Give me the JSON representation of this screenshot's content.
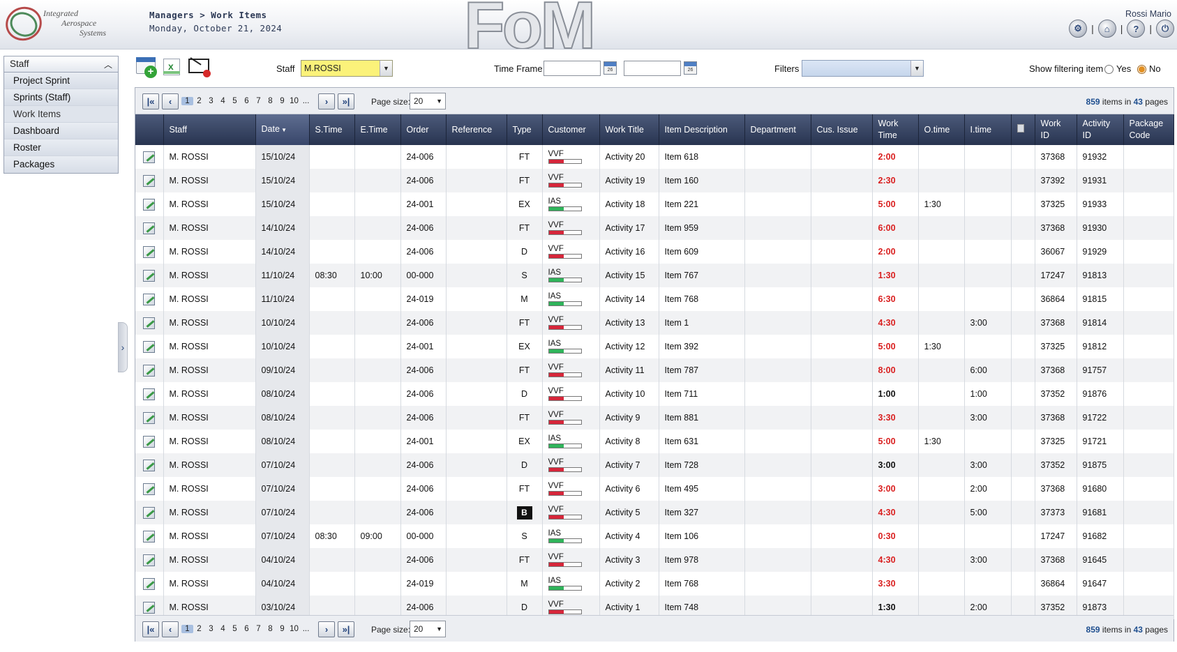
{
  "header": {
    "logo_lines": [
      "Integrated",
      "Aerospace",
      "Systems"
    ],
    "breadcrumb": "Managers > Work Items",
    "date": "Monday, October 21, 2024",
    "watermark": "FoM",
    "user": "Rossi Mario",
    "icons": [
      "gear-icon",
      "home-icon",
      "help-icon",
      "power-icon"
    ]
  },
  "sidebar": {
    "header": "Staff",
    "items": [
      {
        "label": "Project Sprint"
      },
      {
        "label": "Sprints (Staff)"
      },
      {
        "label": "Work Items"
      },
      {
        "label": "Dashboard"
      },
      {
        "label": "Roster"
      },
      {
        "label": "Packages"
      }
    ]
  },
  "toolbar": {
    "staff_label": "Staff",
    "staff_value": "M.ROSSI",
    "timeframe_label": "Time Frame",
    "timeframe_from": "",
    "timeframe_to": "",
    "calendar_glyph": "26",
    "filters_label": "Filters",
    "filters_value": "",
    "show_filtering_label": "Show filtering item",
    "yes": "Yes",
    "no": "No",
    "selected": "No"
  },
  "pager": {
    "pages": [
      "1",
      "2",
      "3",
      "4",
      "5",
      "6",
      "7",
      "8",
      "9",
      "10",
      "..."
    ],
    "current": "1",
    "page_size_label": "Page size:",
    "page_size": "20",
    "total_items": "859",
    "items_in": "items in",
    "total_pages": "43",
    "pages_label": "pages"
  },
  "colors": {
    "header_bg": "#283450",
    "accent_red": "#d91e1e",
    "vvf_bar": "#d6263a",
    "ias_bar": "#2fb35a",
    "staff_select": "#fbf27a"
  },
  "table": {
    "columns": [
      "",
      "Staff",
      "Date",
      "S.Time",
      "E.Time",
      "Order",
      "Reference",
      "Type",
      "Customer",
      "Work Title",
      "Item Description",
      "Department",
      "Cus. Issue",
      "Work Time",
      "O.time",
      "I.time",
      "",
      "Work ID",
      "Activity ID",
      "Package Code"
    ],
    "rows": [
      {
        "staff": "M. ROSSI",
        "date": "15/10/24",
        "stime": "",
        "etime": "",
        "order": "24-006",
        "ref": "",
        "type": "FT",
        "cust": "VVF",
        "title": "Activity 20",
        "desc": "Item 618",
        "dept": "",
        "issue": "",
        "wt": "2:00",
        "wt_red": true,
        "ot": "",
        "it": "",
        "wid": "37368",
        "aid": "91932",
        "pkg": ""
      },
      {
        "staff": "M. ROSSI",
        "date": "15/10/24",
        "stime": "",
        "etime": "",
        "order": "24-006",
        "ref": "",
        "type": "FT",
        "cust": "VVF",
        "title": "Activity 19",
        "desc": "Item 160",
        "dept": "",
        "issue": "",
        "wt": "2:30",
        "wt_red": true,
        "ot": "",
        "it": "",
        "wid": "37392",
        "aid": "91931",
        "pkg": ""
      },
      {
        "staff": "M. ROSSI",
        "date": "15/10/24",
        "stime": "",
        "etime": "",
        "order": "24-001",
        "ref": "",
        "type": "EX",
        "cust": "IAS",
        "title": "Activity 18",
        "desc": "Item 221",
        "dept": "",
        "issue": "",
        "wt": "5:00",
        "wt_red": true,
        "ot": "1:30",
        "it": "",
        "wid": "37325",
        "aid": "91933",
        "pkg": ""
      },
      {
        "staff": "M. ROSSI",
        "date": "14/10/24",
        "stime": "",
        "etime": "",
        "order": "24-006",
        "ref": "",
        "type": "FT",
        "cust": "VVF",
        "title": "Activity 17",
        "desc": "Item 959",
        "dept": "",
        "issue": "",
        "wt": "6:00",
        "wt_red": true,
        "ot": "",
        "it": "",
        "wid": "37368",
        "aid": "91930",
        "pkg": ""
      },
      {
        "staff": "M. ROSSI",
        "date": "14/10/24",
        "stime": "",
        "etime": "",
        "order": "24-006",
        "ref": "",
        "type": "D",
        "cust": "VVF",
        "title": "Activity 16",
        "desc": "Item 609",
        "dept": "",
        "issue": "",
        "wt": "2:00",
        "wt_red": true,
        "ot": "",
        "it": "",
        "wid": "36067",
        "aid": "91929",
        "pkg": ""
      },
      {
        "staff": "M. ROSSI",
        "date": "11/10/24",
        "stime": "08:30",
        "etime": "10:00",
        "order": "00-000",
        "ref": "",
        "type": "S",
        "cust": "IAS",
        "title": "Activity 15",
        "desc": "Item 767",
        "dept": "",
        "issue": "",
        "wt": "1:30",
        "wt_red": true,
        "ot": "",
        "it": "",
        "wid": "17247",
        "aid": "91813",
        "pkg": ""
      },
      {
        "staff": "M. ROSSI",
        "date": "11/10/24",
        "stime": "",
        "etime": "",
        "order": "24-019",
        "ref": "",
        "type": "M",
        "cust": "IAS",
        "title": "Activity 14",
        "desc": "Item 768",
        "dept": "",
        "issue": "",
        "wt": "6:30",
        "wt_red": true,
        "ot": "",
        "it": "",
        "wid": "36864",
        "aid": "91815",
        "pkg": ""
      },
      {
        "staff": "M. ROSSI",
        "date": "10/10/24",
        "stime": "",
        "etime": "",
        "order": "24-006",
        "ref": "",
        "type": "FT",
        "cust": "VVF",
        "title": "Activity 13",
        "desc": "Item 1",
        "dept": "",
        "issue": "",
        "wt": "4:30",
        "wt_red": true,
        "ot": "",
        "it": "3:00",
        "wid": "37368",
        "aid": "91814",
        "pkg": ""
      },
      {
        "staff": "M. ROSSI",
        "date": "10/10/24",
        "stime": "",
        "etime": "",
        "order": "24-001",
        "ref": "",
        "type": "EX",
        "cust": "IAS",
        "title": "Activity 12",
        "desc": "Item 392",
        "dept": "",
        "issue": "",
        "wt": "5:00",
        "wt_red": true,
        "ot": "1:30",
        "it": "",
        "wid": "37325",
        "aid": "91812",
        "pkg": ""
      },
      {
        "staff": "M. ROSSI",
        "date": "09/10/24",
        "stime": "",
        "etime": "",
        "order": "24-006",
        "ref": "",
        "type": "FT",
        "cust": "VVF",
        "title": "Activity 11",
        "desc": "Item 787",
        "dept": "",
        "issue": "",
        "wt": "8:00",
        "wt_red": true,
        "ot": "",
        "it": "6:00",
        "wid": "37368",
        "aid": "91757",
        "pkg": ""
      },
      {
        "staff": "M. ROSSI",
        "date": "08/10/24",
        "stime": "",
        "etime": "",
        "order": "24-006",
        "ref": "",
        "type": "D",
        "cust": "VVF",
        "title": "Activity 10",
        "desc": "Item 711",
        "dept": "",
        "issue": "",
        "wt": "1:00",
        "wt_red": false,
        "ot": "",
        "it": "1:00",
        "wid": "37352",
        "aid": "91876",
        "pkg": ""
      },
      {
        "staff": "M. ROSSI",
        "date": "08/10/24",
        "stime": "",
        "etime": "",
        "order": "24-006",
        "ref": "",
        "type": "FT",
        "cust": "VVF",
        "title": "Activity 9",
        "desc": "Item 881",
        "dept": "",
        "issue": "",
        "wt": "3:30",
        "wt_red": true,
        "ot": "",
        "it": "3:00",
        "wid": "37368",
        "aid": "91722",
        "pkg": ""
      },
      {
        "staff": "M. ROSSI",
        "date": "08/10/24",
        "stime": "",
        "etime": "",
        "order": "24-001",
        "ref": "",
        "type": "EX",
        "cust": "IAS",
        "title": "Activity 8",
        "desc": "Item 631",
        "dept": "",
        "issue": "",
        "wt": "5:00",
        "wt_red": true,
        "ot": "1:30",
        "it": "",
        "wid": "37325",
        "aid": "91721",
        "pkg": ""
      },
      {
        "staff": "M. ROSSI",
        "date": "07/10/24",
        "stime": "",
        "etime": "",
        "order": "24-006",
        "ref": "",
        "type": "D",
        "cust": "VVF",
        "title": "Activity 7",
        "desc": "Item 728",
        "dept": "",
        "issue": "",
        "wt": "3:00",
        "wt_red": false,
        "ot": "",
        "it": "3:00",
        "wid": "37352",
        "aid": "91875",
        "pkg": ""
      },
      {
        "staff": "M. ROSSI",
        "date": "07/10/24",
        "stime": "",
        "etime": "",
        "order": "24-006",
        "ref": "",
        "type": "FT",
        "cust": "VVF",
        "title": "Activity 6",
        "desc": "Item 495",
        "dept": "",
        "issue": "",
        "wt": "3:00",
        "wt_red": true,
        "ot": "",
        "it": "2:00",
        "wid": "37368",
        "aid": "91680",
        "pkg": ""
      },
      {
        "staff": "M. ROSSI",
        "date": "07/10/24",
        "stime": "",
        "etime": "",
        "order": "24-006",
        "ref": "",
        "type": "B",
        "type_badge": true,
        "cust": "VVF",
        "title": "Activity 5",
        "desc": "Item 327",
        "dept": "",
        "issue": "",
        "wt": "4:30",
        "wt_red": true,
        "ot": "",
        "it": "5:00",
        "wid": "37373",
        "aid": "91681",
        "pkg": ""
      },
      {
        "staff": "M. ROSSI",
        "date": "07/10/24",
        "stime": "08:30",
        "etime": "09:00",
        "order": "00-000",
        "ref": "",
        "type": "S",
        "cust": "IAS",
        "title": "Activity 4",
        "desc": "Item 106",
        "dept": "",
        "issue": "",
        "wt": "0:30",
        "wt_red": true,
        "ot": "",
        "it": "",
        "wid": "17247",
        "aid": "91682",
        "pkg": ""
      },
      {
        "staff": "M. ROSSI",
        "date": "04/10/24",
        "stime": "",
        "etime": "",
        "order": "24-006",
        "ref": "",
        "type": "FT",
        "cust": "VVF",
        "title": "Activity 3",
        "desc": "Item 978",
        "dept": "",
        "issue": "",
        "wt": "4:30",
        "wt_red": true,
        "ot": "",
        "it": "3:00",
        "wid": "37368",
        "aid": "91645",
        "pkg": ""
      },
      {
        "staff": "M. ROSSI",
        "date": "04/10/24",
        "stime": "",
        "etime": "",
        "order": "24-019",
        "ref": "",
        "type": "M",
        "cust": "IAS",
        "title": "Activity 2",
        "desc": "Item 768",
        "dept": "",
        "issue": "",
        "wt": "3:30",
        "wt_red": true,
        "ot": "",
        "it": "",
        "wid": "36864",
        "aid": "91647",
        "pkg": ""
      },
      {
        "staff": "M. ROSSI",
        "date": "03/10/24",
        "stime": "",
        "etime": "",
        "order": "24-006",
        "ref": "",
        "type": "D",
        "cust": "VVF",
        "title": "Activity 1",
        "desc": "Item 748",
        "dept": "",
        "issue": "",
        "wt": "1:30",
        "wt_red": false,
        "ot": "",
        "it": "2:00",
        "wid": "37352",
        "aid": "91873",
        "pkg": ""
      }
    ]
  }
}
